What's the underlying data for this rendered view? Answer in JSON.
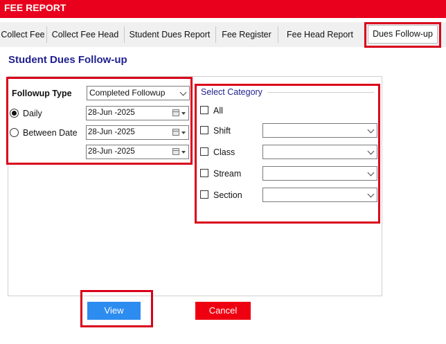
{
  "window": {
    "title": "FEE REPORT"
  },
  "tabs": [
    {
      "label": "Collect Fee"
    },
    {
      "label": "Collect Fee Head"
    },
    {
      "label": "Student Dues Report"
    },
    {
      "label": "Fee Register"
    },
    {
      "label": "Fee Head Report"
    },
    {
      "label": "Dues Follow-up"
    }
  ],
  "active_tab": "Dues Follow-up",
  "page": {
    "title": "Student Dues Follow-up"
  },
  "followup": {
    "type_label": "Followup Type",
    "type_value": "Completed Followup",
    "daily_label": "Daily",
    "between_label": "Between Date",
    "daily_date": "28-Jun -2025",
    "from_date": "28-Jun -2025",
    "to_date": "28-Jun -2025",
    "selected_mode": "Daily"
  },
  "category": {
    "title": "Select Category",
    "all_label": "All",
    "shift_label": "Shift",
    "class_label": "Class",
    "stream_label": "Stream",
    "section_label": "Section",
    "shift_value": "",
    "class_value": "",
    "stream_value": "",
    "section_value": ""
  },
  "buttons": {
    "view": "View",
    "cancel": "Cancel"
  },
  "colors": {
    "header": "#e8001c",
    "view_button": "#2d8cf0",
    "cancel_button": "#ee0010",
    "highlight": "#d9001a",
    "title_text": "#1f1f8f"
  }
}
